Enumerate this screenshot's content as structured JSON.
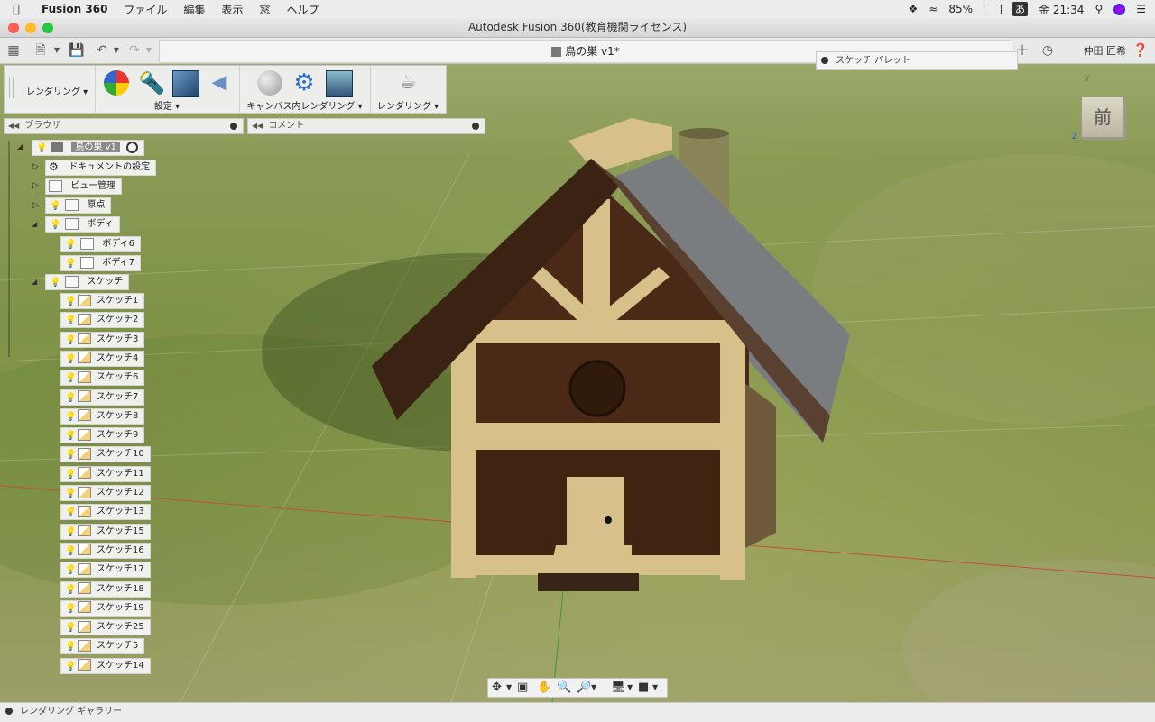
{
  "menubar": {
    "app_name": "Fusion 360",
    "items": [
      "ファイル",
      "編集",
      "表示",
      "窓",
      "ヘルプ"
    ],
    "battery": "85%",
    "input_method": "あ",
    "clock": "金 21:34"
  },
  "window": {
    "title": "Autodesk Fusion 360(教育機関ライセンス)"
  },
  "doc_tab": {
    "title": "鳥の巣 v1*"
  },
  "user": {
    "name": "仲田 匠希"
  },
  "ribbon": {
    "workspace": "レンダリング",
    "settings_label": "設定",
    "canvas_render_label": "キャンバス内レンダリング",
    "render_label": "レンダリング"
  },
  "sketch_palette": {
    "label": "スケッチ パレット"
  },
  "browser": {
    "label": "ブラウザ"
  },
  "comments": {
    "label": "コメント"
  },
  "tree": {
    "root": "鳥の巣 v1",
    "doc_settings": "ドキュメントの設定",
    "view_mgmt": "ビュー管理",
    "origin": "原点",
    "bodies": "ボディ",
    "body_items": [
      "ボディ6",
      "ボディ7"
    ],
    "sketches": "スケッチ",
    "sketch_items": [
      "スケッチ1",
      "スケッチ2",
      "スケッチ3",
      "スケッチ4",
      "スケッチ6",
      "スケッチ7",
      "スケッチ8",
      "スケッチ9",
      "スケッチ10",
      "スケッチ11",
      "スケッチ12",
      "スケッチ13",
      "スケッチ15",
      "スケッチ16",
      "スケッチ17",
      "スケッチ18",
      "スケッチ19",
      "スケッチ25",
      "スケッチ5",
      "スケッチ14"
    ]
  },
  "navcube": {
    "face": "前",
    "axis_y": "Y",
    "axis_z": "Z"
  },
  "statusbar": {
    "label": "レンダリング ギャラリー"
  },
  "colors": {
    "roof_dark": "#3b2314",
    "roof_grey": "#7a7d80",
    "trim": "#d8c08a",
    "wall": "#4a2a16",
    "chimney": "#8a8558"
  }
}
